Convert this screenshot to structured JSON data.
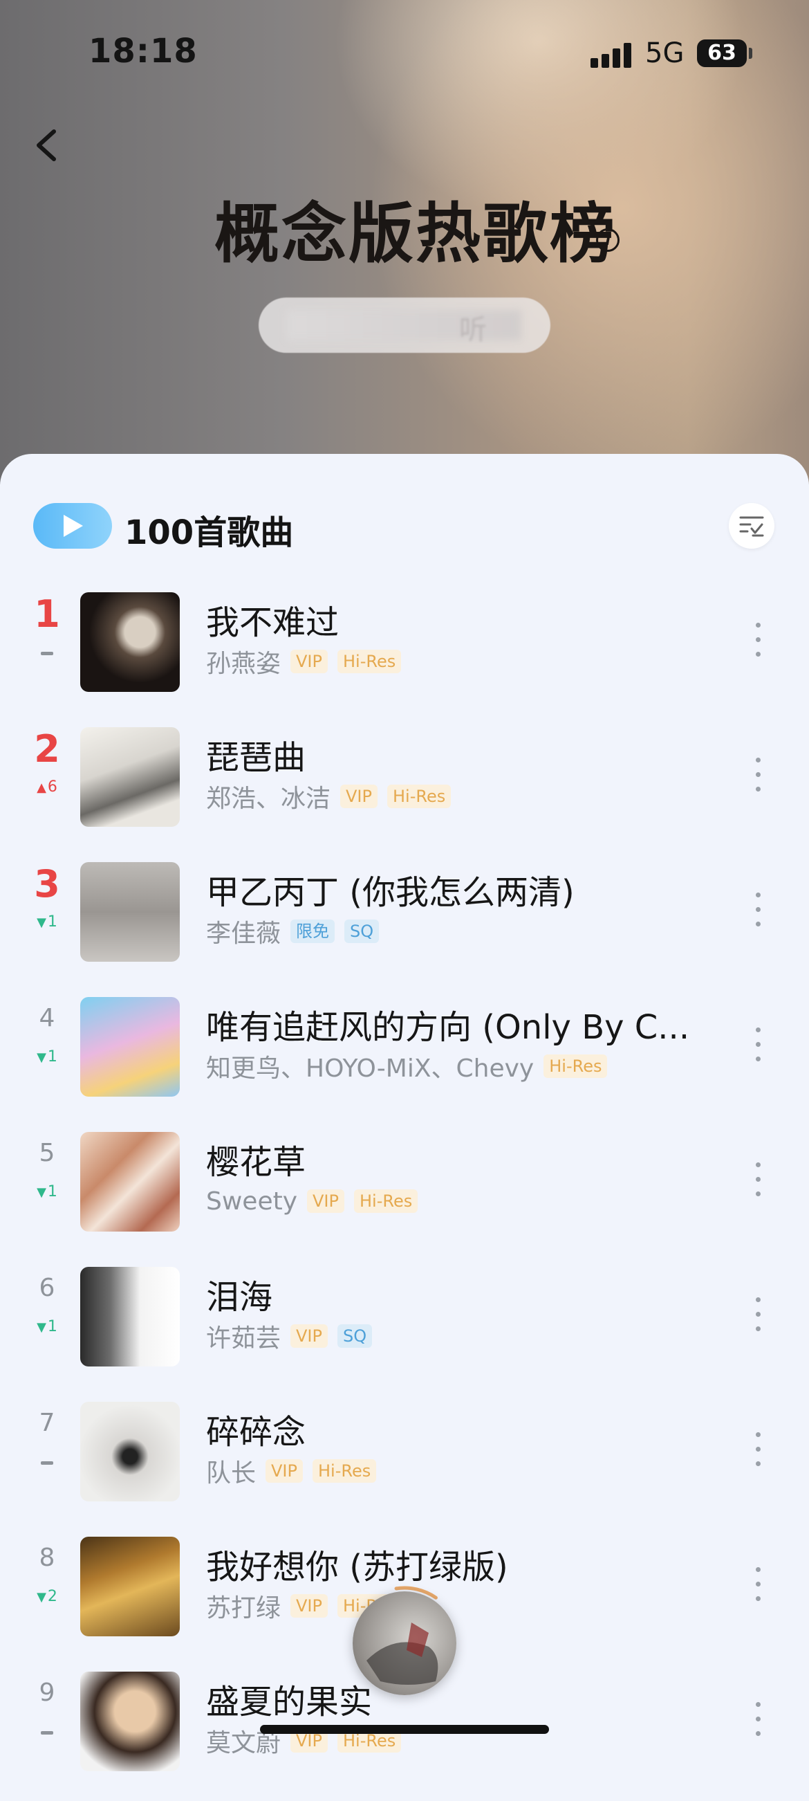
{
  "status_bar": {
    "time": "18:18",
    "network": "5G",
    "battery": "63"
  },
  "header": {
    "title": "概念版热歌榜",
    "info_icon": "info-icon",
    "blurred_button_label": "听"
  },
  "list_header": {
    "song_count_label": "100首歌曲",
    "play_icon": "play-icon",
    "sort_icon": "sort-icon"
  },
  "songs": [
    {
      "rank": "1",
      "trend": "same",
      "trend_value": "",
      "title": "我不难过",
      "artist": "孙燕姿",
      "tags": [
        "VIP",
        "Hi-Res"
      ]
    },
    {
      "rank": "2",
      "trend": "up",
      "trend_value": "6",
      "title": "琵琶曲",
      "artist": "郑浩、冰洁",
      "tags": [
        "VIP",
        "Hi-Res"
      ]
    },
    {
      "rank": "3",
      "trend": "down",
      "trend_value": "1",
      "title": "甲乙丙丁 (你我怎么两清)",
      "artist": "李佳薇",
      "tags": [
        "限免",
        "SQ"
      ]
    },
    {
      "rank": "4",
      "trend": "down",
      "trend_value": "1",
      "title": "唯有追赶风的方向 (Only By C...",
      "artist": "知更鸟、HOYO-MiX、Chevy",
      "tags": [
        "Hi-Res"
      ]
    },
    {
      "rank": "5",
      "trend": "down",
      "trend_value": "1",
      "title": "樱花草",
      "artist": "Sweety",
      "tags": [
        "VIP",
        "Hi-Res"
      ]
    },
    {
      "rank": "6",
      "trend": "down",
      "trend_value": "1",
      "title": "泪海",
      "artist": "许茹芸",
      "tags": [
        "VIP",
        "SQ"
      ]
    },
    {
      "rank": "7",
      "trend": "same",
      "trend_value": "",
      "title": "碎碎念",
      "artist": "队长",
      "tags": [
        "VIP",
        "Hi-Res"
      ]
    },
    {
      "rank": "8",
      "trend": "down",
      "trend_value": "2",
      "title": "我好想你 (苏打绿版)",
      "artist": "苏打绿",
      "tags": [
        "VIP",
        "Hi-Res"
      ]
    },
    {
      "rank": "9",
      "trend": "same",
      "trend_value": "",
      "title": "盛夏的果实",
      "artist": "莫文蔚",
      "tags": [
        "VIP",
        "Hi-Res"
      ]
    }
  ],
  "colors": {
    "top_rank": "#e84545",
    "trend_up": "#e84545",
    "trend_down": "#2fb88b",
    "gold_tag": "#e5a94f",
    "blue_tag": "#4ea0d8",
    "play_button": "#5ab9f7"
  },
  "mini_player": {
    "progress": 0.12
  }
}
